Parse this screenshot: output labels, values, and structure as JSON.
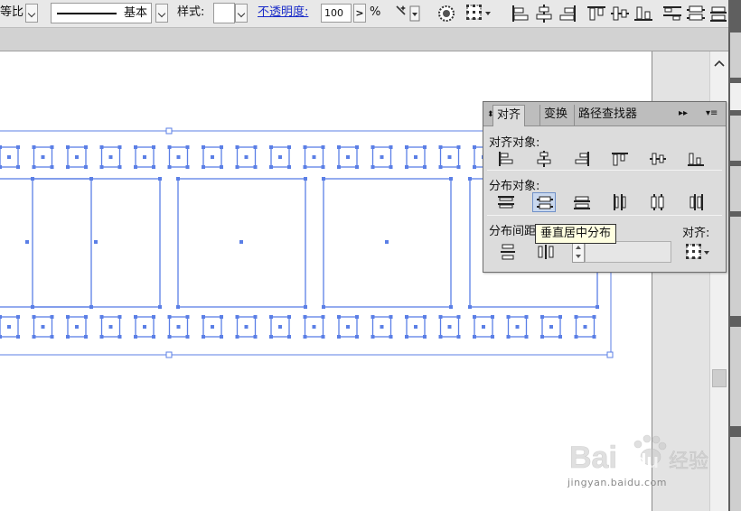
{
  "control_bar": {
    "proportion_label": "等比",
    "stroke_profile_label": "基本",
    "style_label": "样式:",
    "opacity_label": "不透明度:",
    "opacity_value": "100",
    "opacity_unit": "%",
    "icons": [
      "recolor-icon",
      "wand-icon",
      "transform-ref-icon",
      "align-left-icon",
      "align-hcenter-icon",
      "align-right-icon",
      "align-top-icon",
      "align-vcenter-icon",
      "align-bottom-icon",
      "dist-top-icon",
      "dist-vcenter-icon",
      "dist-bottom-icon"
    ]
  },
  "align_panel": {
    "tabs": [
      {
        "label": "对齐",
        "active": true
      },
      {
        "label": "变换",
        "active": false
      },
      {
        "label": "路径查找器",
        "active": false
      }
    ],
    "collapse_glyph": "▸▸",
    "menu_glyph": "▾≡",
    "align_objects_label": "对齐对象:",
    "distribute_objects_label": "分布对象:",
    "distribute_spacing_label": "分布间距",
    "align_to_label": "对齐:",
    "tooltip": "垂直居中分布"
  },
  "watermark": {
    "brand": "Bai du 经验",
    "url": "jingyan.baidu.com"
  },
  "colors": {
    "selection_blue": "#5b7fe6",
    "hover_blue": "#c9d8ee",
    "panel_bg": "#dcdcdc"
  }
}
